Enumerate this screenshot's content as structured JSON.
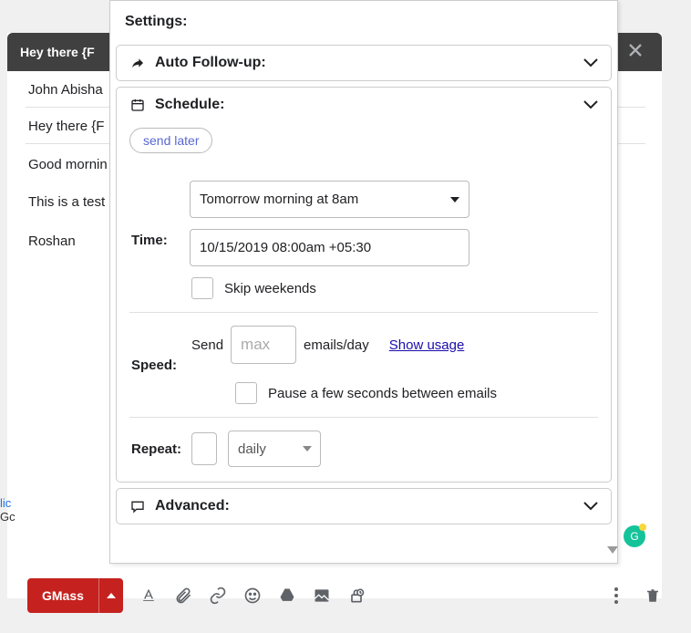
{
  "compose": {
    "subject_header": "Hey there {F",
    "to": "John Abisha",
    "subject": "Hey there {F",
    "greeting": "Good mornin",
    "line1": "This is a test",
    "signature": "Roshan"
  },
  "settings": {
    "title": "Settings:",
    "auto_followup": {
      "label": "Auto Follow-up:"
    },
    "schedule": {
      "label": "Schedule:",
      "send_later_btn": "send later",
      "time_label": "Time:",
      "time_select_value": "Tomorrow morning at 8am",
      "datetime_value": "10/15/2019 08:00am +05:30",
      "skip_weekends_label": "Skip weekends",
      "speed_label": "Speed:",
      "speed_prefix": "Send",
      "max_placeholder": "max",
      "speed_suffix": "emails/day",
      "show_usage": "Show usage",
      "pause_label": "Pause a few seconds between emails",
      "repeat_label": "Repeat:",
      "repeat_freq_value": "daily"
    },
    "advanced": {
      "label": "Advanced:"
    }
  },
  "toolbar": {
    "gmass_label": "GMass"
  },
  "truncated": {
    "line1": "lic",
    "line2": "Gc"
  }
}
